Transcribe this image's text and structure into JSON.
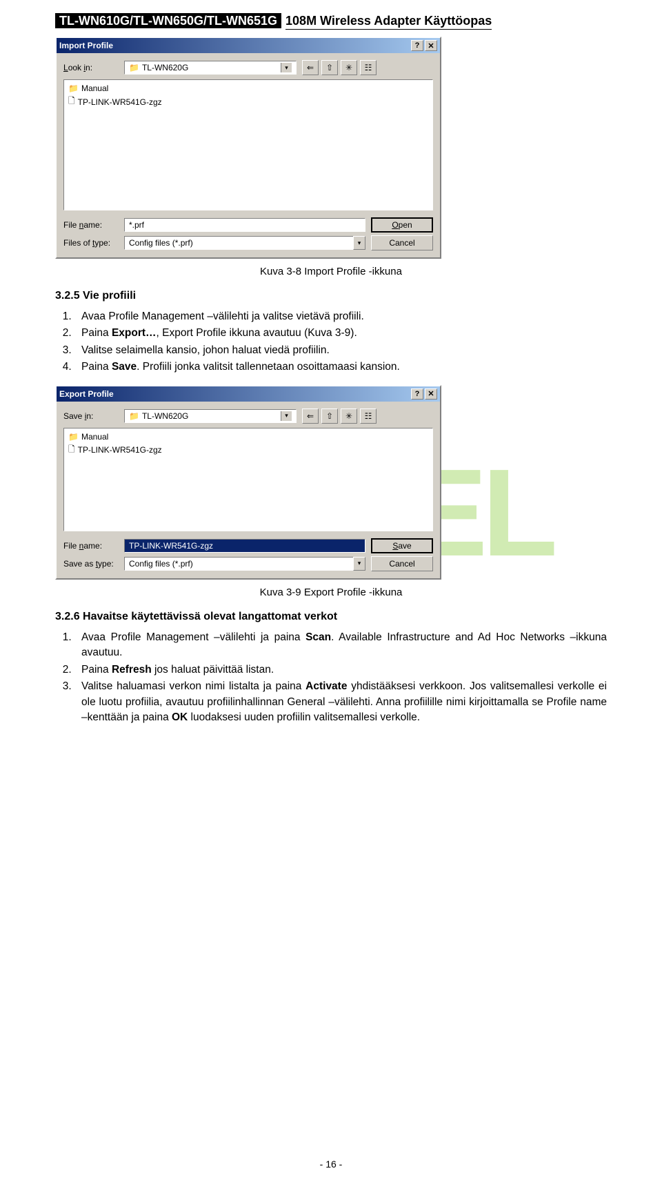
{
  "header": {
    "models": "TL-WN610G/TL-WN650G/TL-WN651G",
    "title": "108M Wireless Adapter Käyttöopas"
  },
  "watermark": "WINTEL",
  "dialog1": {
    "title": "Import Profile",
    "lookin_label": "Look in:",
    "lookin_value": "TL-WN620G",
    "nav_back": "⇐",
    "nav_up": "⇧",
    "nav_newfolder": "✳",
    "nav_view": "☷",
    "files": [
      "Manual",
      "TP-LINK-WR541G-zgz"
    ],
    "filename_label": "File name:",
    "filename_value": "*.prf",
    "filetype_label": "Files of type:",
    "filetype_value": "Config files (*.prf)",
    "open_label": "Open",
    "cancel_label": "Cancel"
  },
  "caption1": "Kuva 3-8   Import Profile -ikkuna",
  "section1": {
    "heading": "3.2.5 Vie profiili",
    "items": [
      [
        {
          "t": "Avaa Profile Management –välilehti ja valitse vietävä profiili."
        }
      ],
      [
        {
          "t": "Paina "
        },
        {
          "b": "Export…"
        },
        {
          "t": ", Export Profile ikkuna avautuu (Kuva 3-9)."
        }
      ],
      [
        {
          "t": "Valitse selaimella kansio, johon haluat viedä profiilin."
        }
      ],
      [
        {
          "t": "Paina "
        },
        {
          "b": "Save"
        },
        {
          "t": ". Profiili jonka valitsit tallennetaan osoittamaasi kansion."
        }
      ]
    ]
  },
  "dialog2": {
    "title": "Export Profile",
    "savein_label": "Save in:",
    "savein_value": "TL-WN620G",
    "files": [
      "Manual",
      "TP-LINK-WR541G-zgz"
    ],
    "filename_label": "File name:",
    "filename_value": "TP-LINK-WR541G-zgz",
    "saveas_label": "Save as type:",
    "saveas_value": "Config files (*.prf)",
    "save_label": "Save",
    "cancel_label": "Cancel"
  },
  "caption2": "Kuva 3-9   Export Profile -ikkuna",
  "section2": {
    "heading": "3.2.6 Havaitse käytettävissä olevat langattomat verkot",
    "items": [
      [
        {
          "t": "Avaa Profile Management –välilehti ja paina "
        },
        {
          "b": "Scan"
        },
        {
          "t": ". Available Infrastructure and Ad Hoc Networks –ikkuna avautuu."
        }
      ],
      [
        {
          "t": "Paina "
        },
        {
          "b": "Refresh"
        },
        {
          "t": " jos haluat päivittää listan."
        }
      ],
      [
        {
          "t": "Valitse haluamasi verkon nimi listalta ja paina "
        },
        {
          "b": "Activate"
        },
        {
          "t": " yhdistääksesi verkkoon. Jos valitsemallesi verkolle ei ole luotu profiilia, avautuu profiilinhallinnan General –välilehti. Anna profiilille nimi kirjoittamalla se Profile name –kenttään ja paina "
        },
        {
          "b": "OK"
        },
        {
          "t": " luodaksesi uuden profiilin valitsemallesi verkolle."
        }
      ]
    ]
  },
  "page_number": "- 16 -"
}
